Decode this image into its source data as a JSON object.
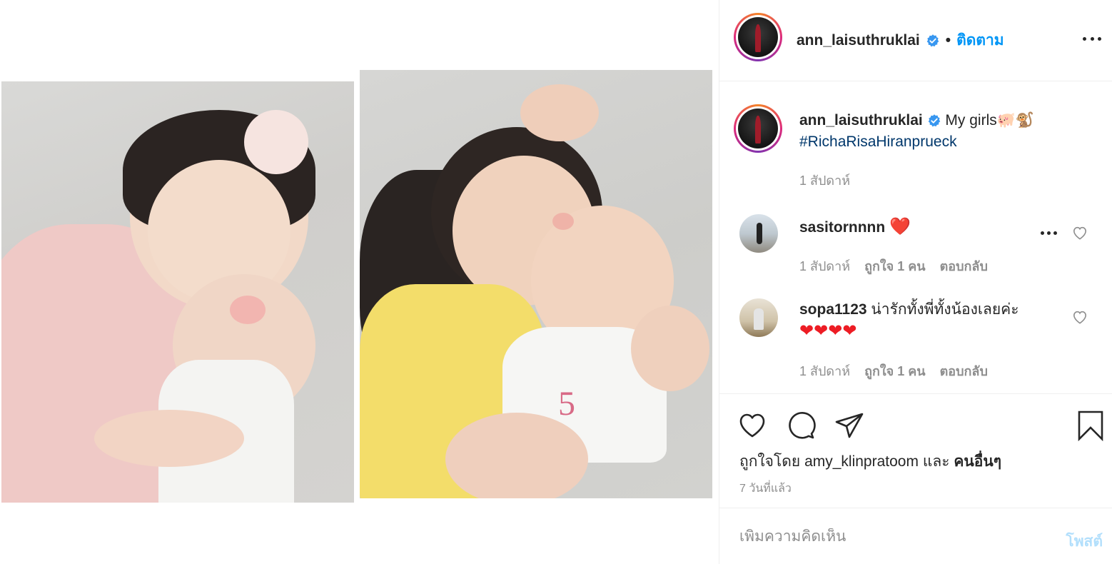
{
  "post": {
    "media_alt": ""
  },
  "header": {
    "username": "ann_laisuthruklai",
    "separator": "•",
    "follow_label": "ติดตาม"
  },
  "caption": {
    "username": "ann_laisuthruklai",
    "text": "My girls🐖🐒",
    "hashtag": "#RichaRisaHiranprueck",
    "time": "1 สัปดาห์"
  },
  "comments": [
    {
      "username": "sasitornnnn",
      "text": "❤️",
      "time": "1 สัปดาห์",
      "reply": ""
    },
    {
      "username": "sopa1123",
      "text": "น่ารักทั้งพี่ทั้งน้องเลยค่ะ",
      "hearts": "❤❤❤❤",
      "time": "1 สัปดาห์",
      "likes": "ถูกใจ 1 คน",
      "reply": "ตอบกลับ"
    }
  ],
  "comment1_meta": {
    "likes": "ถูกใจ 1 คน",
    "reply": "ตอบกลับ"
  },
  "likes": {
    "prefix": "ถูกใจโดย",
    "user": "amy_klinpratoom",
    "and": "และ",
    "others": "คนอื่นๆ"
  },
  "post_time": "7 วันที่แล้ว",
  "add_comment": {
    "placeholder": "เพิ่มความคิดเห็น",
    "post_label": "โพสต์"
  },
  "colors": {
    "accent": "#0095f6",
    "verified": "#3897f0",
    "hashtag": "#00376b",
    "muted": "#8e8e8e"
  }
}
